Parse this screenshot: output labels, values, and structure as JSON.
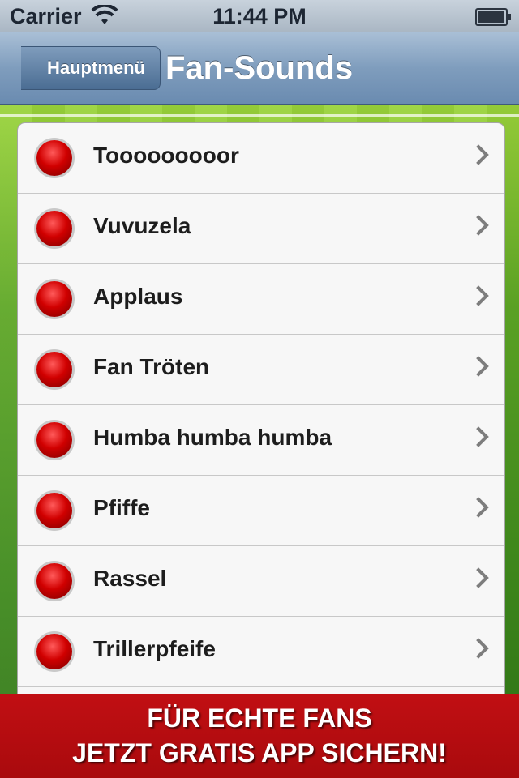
{
  "status_bar": {
    "carrier": "Carrier",
    "time": "11:44 PM"
  },
  "nav": {
    "back_label": "Hauptmenü",
    "title": "Fan-Sounds"
  },
  "sounds": [
    {
      "label": "Tooooooooor"
    },
    {
      "label": "Vuvuzela"
    },
    {
      "label": "Applaus"
    },
    {
      "label": "Fan Tröten"
    },
    {
      "label": "Humba humba humba"
    },
    {
      "label": "Pfiffe"
    },
    {
      "label": "Rassel"
    },
    {
      "label": "Trillerpfeife"
    }
  ],
  "banner": {
    "line1": "FÜR ECHTE FANS",
    "line2": "JETZT GRATIS APP SICHERN!"
  },
  "colors": {
    "record_red": "#d10000",
    "banner_red": "#c10f13",
    "nav_blue": "#6a8bb0"
  }
}
